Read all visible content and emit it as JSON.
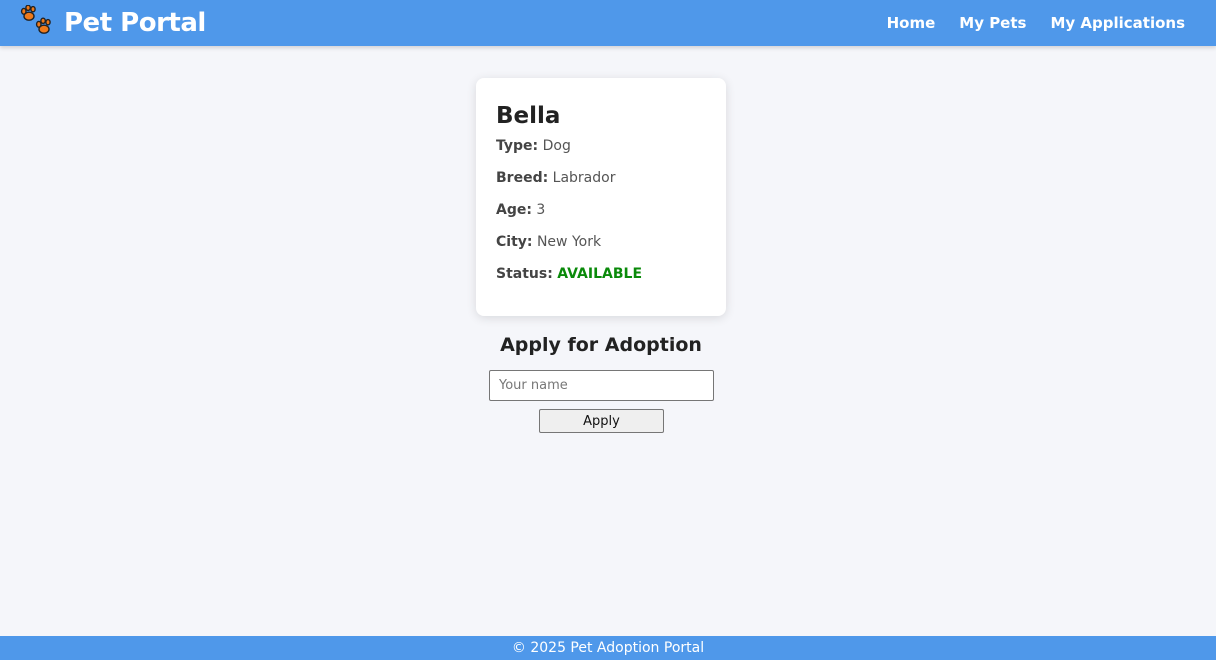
{
  "navbar": {
    "brand_title": "Pet Portal",
    "logo_icon": "paw-prints-icon",
    "links": [
      {
        "label": "Home"
      },
      {
        "label": "My Pets"
      },
      {
        "label": "My Applications"
      }
    ],
    "background_color": "#4f98ea",
    "logo_color": "#f07a1a"
  },
  "pet": {
    "name": "Bella",
    "fields": {
      "type": {
        "label": "Type:",
        "value": "Dog"
      },
      "breed": {
        "label": "Breed:",
        "value": "Labrador"
      },
      "age": {
        "label": "Age:",
        "value": "3"
      },
      "city": {
        "label": "City:",
        "value": "New York"
      },
      "status": {
        "label": "Status:",
        "value": "AVAILABLE",
        "color": "#0a8a0a"
      }
    }
  },
  "adoption_form": {
    "heading": "Apply for Adoption",
    "name_input": {
      "value": "",
      "placeholder": "Your name"
    },
    "submit_label": "Apply"
  },
  "footer": {
    "text": "© 2025 Pet Adoption Portal"
  }
}
